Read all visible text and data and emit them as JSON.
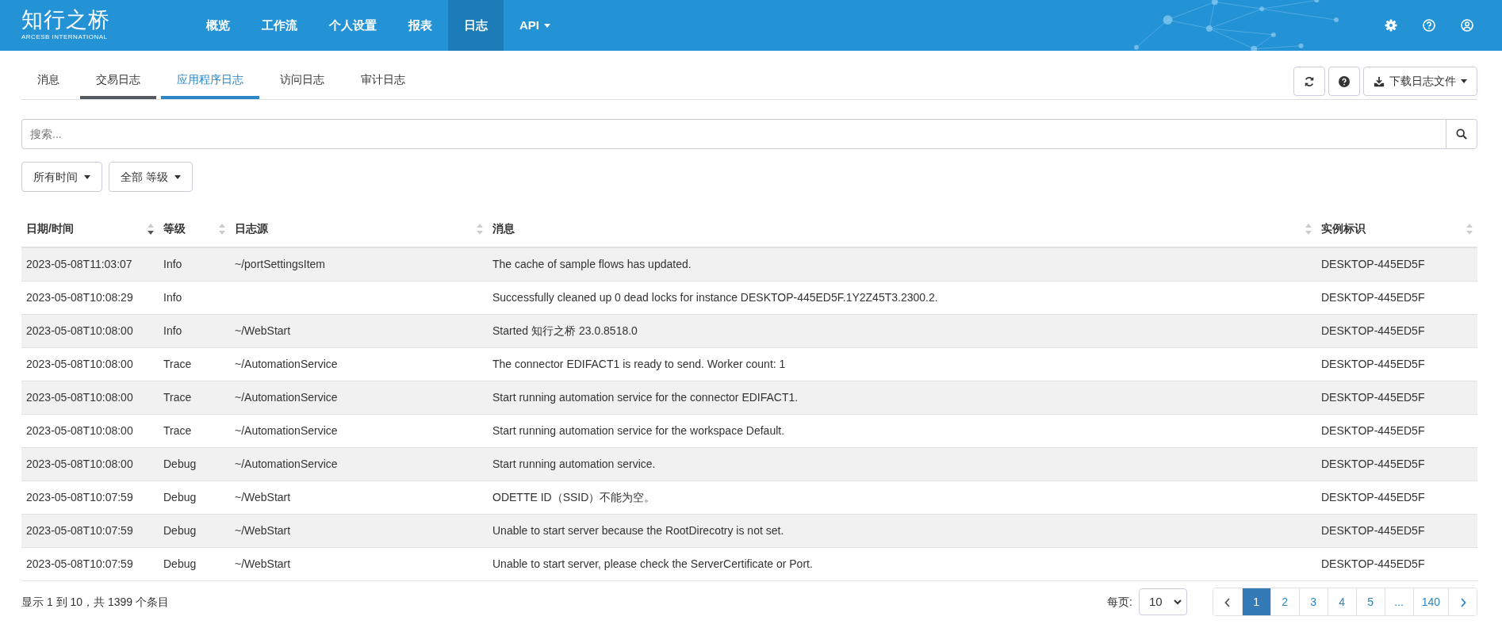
{
  "brand": {
    "name": "知行之桥",
    "subtitle": "ARCESB INTERNATIONAL"
  },
  "nav": [
    {
      "label": "概览",
      "selected": false,
      "dropdown": false
    },
    {
      "label": "工作流",
      "selected": false,
      "dropdown": false
    },
    {
      "label": "个人设置",
      "selected": false,
      "dropdown": false
    },
    {
      "label": "报表",
      "selected": false,
      "dropdown": false
    },
    {
      "label": "日志",
      "selected": true,
      "dropdown": false
    },
    {
      "label": "API",
      "selected": false,
      "dropdown": true
    }
  ],
  "tabs": [
    {
      "label": "消息",
      "selected": false,
      "hovered": false
    },
    {
      "label": "交易日志",
      "selected": false,
      "hovered": true
    },
    {
      "label": "应用程序日志",
      "selected": true,
      "hovered": false
    },
    {
      "label": "访问日志",
      "selected": false,
      "hovered": false
    },
    {
      "label": "审计日志",
      "selected": false,
      "hovered": false
    }
  ],
  "download_button": "下载日志文件",
  "search": {
    "placeholder": "搜索..."
  },
  "filters": [
    "所有时间",
    "全部 等级"
  ],
  "table": {
    "columns": [
      {
        "label": "日期/时间",
        "sorted_desc": true
      },
      {
        "label": "等级",
        "sorted_desc": false
      },
      {
        "label": "日志源",
        "sorted_desc": false
      },
      {
        "label": "消息",
        "sorted_desc": false
      },
      {
        "label": "实例标识",
        "sorted_desc": false
      }
    ],
    "rows": [
      [
        "2023-05-08T11:03:07",
        "Info",
        "~/portSettingsItem",
        "The cache of sample flows has updated.",
        "DESKTOP-445ED5F"
      ],
      [
        "2023-05-08T10:08:29",
        "Info",
        "",
        "Successfully cleaned up 0 dead locks for instance DESKTOP-445ED5F.1Y2Z45T3.2300.2.",
        "DESKTOP-445ED5F"
      ],
      [
        "2023-05-08T10:08:00",
        "Info",
        "~/WebStart",
        "Started 知行之桥 23.0.8518.0",
        "DESKTOP-445ED5F"
      ],
      [
        "2023-05-08T10:08:00",
        "Trace",
        "~/AutomationService",
        "The connector EDIFACT1 is ready to send. Worker count: 1",
        "DESKTOP-445ED5F"
      ],
      [
        "2023-05-08T10:08:00",
        "Trace",
        "~/AutomationService",
        "Start running automation service for the connector EDIFACT1.",
        "DESKTOP-445ED5F"
      ],
      [
        "2023-05-08T10:08:00",
        "Trace",
        "~/AutomationService",
        "Start running automation service for the workspace Default.",
        "DESKTOP-445ED5F"
      ],
      [
        "2023-05-08T10:08:00",
        "Debug",
        "~/AutomationService",
        "Start running automation service.",
        "DESKTOP-445ED5F"
      ],
      [
        "2023-05-08T10:07:59",
        "Debug",
        "~/WebStart",
        "ODETTE ID（SSID）不能为空。",
        "DESKTOP-445ED5F"
      ],
      [
        "2023-05-08T10:07:59",
        "Debug",
        "~/WebStart",
        "Unable to start server because the RootDirecotry is not set.",
        "DESKTOP-445ED5F"
      ],
      [
        "2023-05-08T10:07:59",
        "Debug",
        "~/WebStart",
        "Unable to start server, please check the ServerCertificate or Port.",
        "DESKTOP-445ED5F"
      ]
    ]
  },
  "footer": {
    "summary": "显示 1 到 10，共 1399 个条目",
    "per_page_label": "每页:",
    "per_page": "10",
    "pages": [
      {
        "label": "1",
        "selected": true
      },
      {
        "label": "2",
        "selected": false
      },
      {
        "label": "3",
        "selected": false
      },
      {
        "label": "4",
        "selected": false
      },
      {
        "label": "5",
        "selected": false
      },
      {
        "label": "...",
        "selected": false
      },
      {
        "label": "140",
        "selected": false
      }
    ]
  }
}
